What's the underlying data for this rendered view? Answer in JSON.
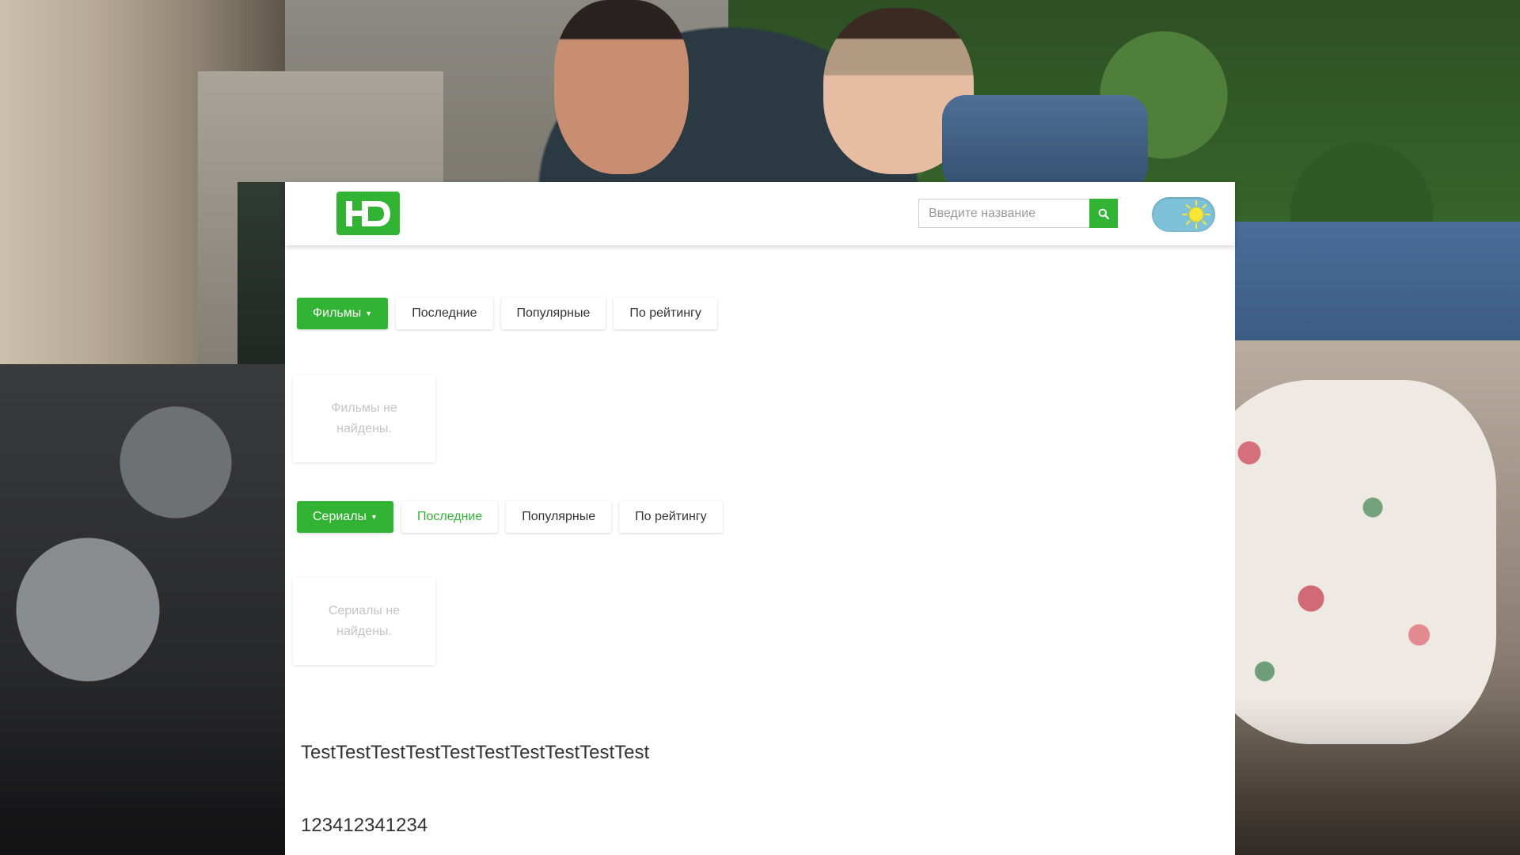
{
  "header": {
    "logo_text": "HD",
    "search": {
      "placeholder": "Введите название",
      "value": ""
    },
    "search_button_icon": "search-icon",
    "theme_toggle": {
      "icon": "sun-icon",
      "state": "light"
    }
  },
  "movies": {
    "tabs": [
      {
        "label": "Фильмы",
        "style": "primary",
        "has_caret": true
      },
      {
        "label": "Последние"
      },
      {
        "label": "Популярные"
      },
      {
        "label": "По рейтингу"
      }
    ],
    "empty_message": "Фильмы не найдены."
  },
  "series": {
    "tabs": [
      {
        "label": "Сериалы",
        "style": "primary",
        "has_caret": true
      },
      {
        "label": "Последние",
        "style": "active"
      },
      {
        "label": "Популярные"
      },
      {
        "label": "По рейтингу"
      }
    ],
    "empty_message": "Сериалы не найдены."
  },
  "footer": {
    "line1": "TestTestTestTestTestTestTestTestTestTest",
    "line2": "123412341234"
  },
  "colors": {
    "accent": "#31b333",
    "toggle_bg": "#7ec1d8",
    "sun": "#f7e636"
  }
}
